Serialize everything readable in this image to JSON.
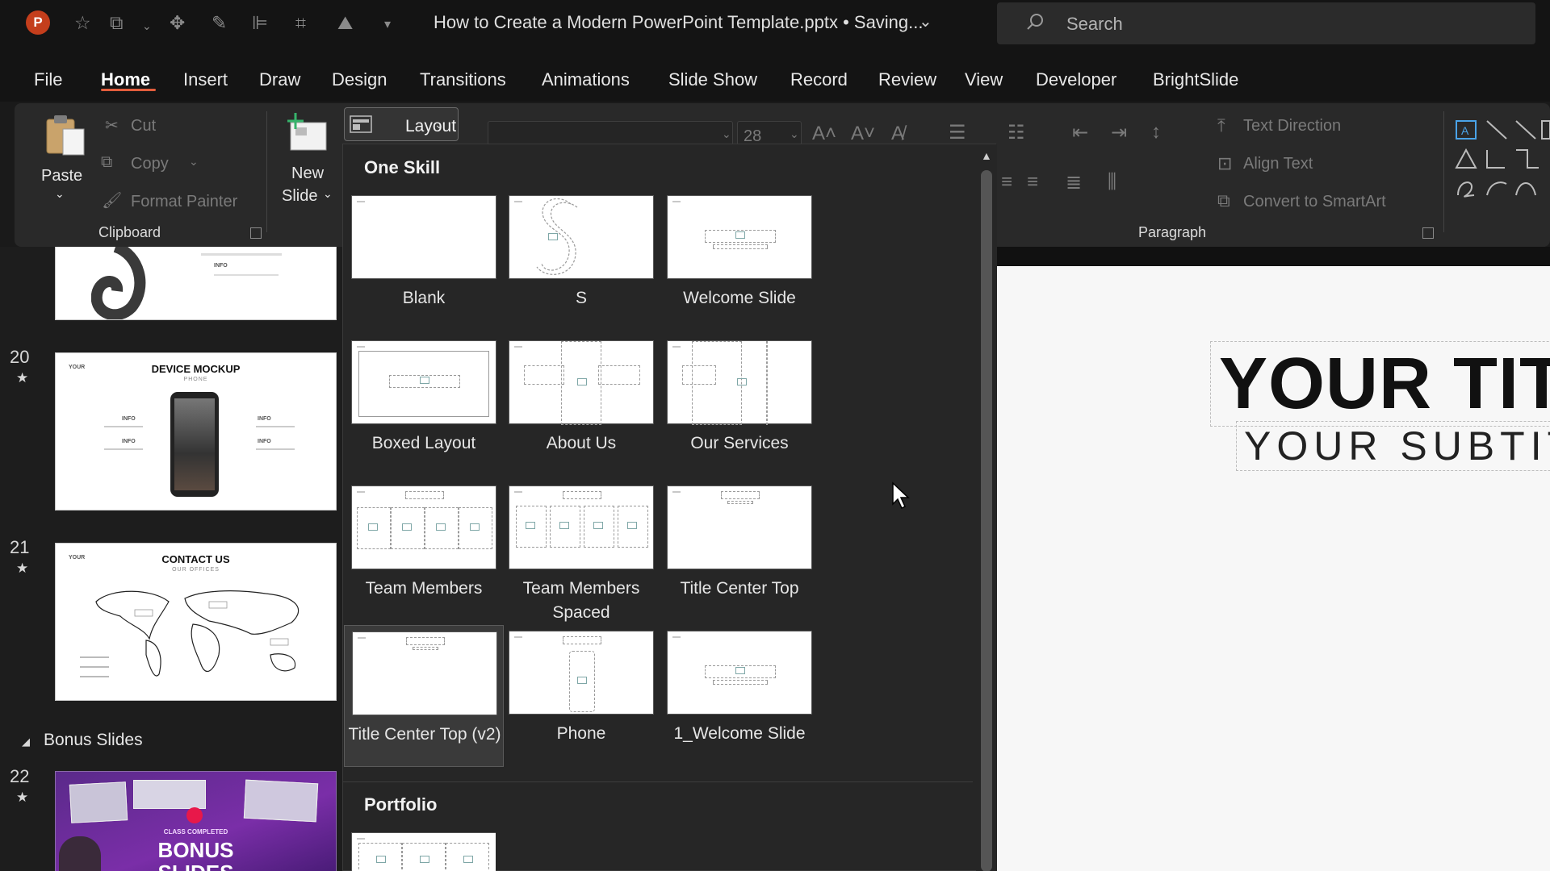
{
  "title_bar": {
    "app_logo": "P",
    "document_title": "How to Create a Modern PowerPoint Template.pptx • Saving...",
    "title_chevron": "⌄",
    "search_placeholder": "Search",
    "qat_icons": [
      "star-icon",
      "slides-icon",
      "move-icon",
      "pen-icon",
      "align-icon",
      "crop-icon",
      "picture-icon",
      "customize-icon"
    ]
  },
  "menu": {
    "tabs": [
      "File",
      "Home",
      "Insert",
      "Draw",
      "Design",
      "Transitions",
      "Animations",
      "Slide Show",
      "Record",
      "Review",
      "View",
      "Developer",
      "BrightSlide"
    ],
    "active_tab": "Home",
    "accent_color": "#e25d3c"
  },
  "ribbon": {
    "clipboard": {
      "paste": "Paste",
      "cut": "Cut",
      "copy": "Copy",
      "format_painter": "Format Painter",
      "group_label": "Clipboard"
    },
    "slides": {
      "new_slide_line1": "New",
      "new_slide_line2": "Slide",
      "layout": "Layout"
    },
    "font": {
      "font_size": "28"
    },
    "paragraph": {
      "text_direction": "Text Direction",
      "align_text": "Align Text",
      "convert_smartart": "Convert to SmartArt",
      "group_label": "Paragraph"
    }
  },
  "slide_panel": {
    "slides": [
      {
        "number": "20",
        "title": "DEVICE MOCKUP",
        "subtitle": "PHONE",
        "info": "INFO",
        "your": "YOUR"
      },
      {
        "number": "21",
        "title": "CONTACT US",
        "subtitle": "OUR OFFICES",
        "your": "YOUR"
      },
      {
        "number": "22",
        "kicker": "CLASS COMPLETED",
        "title": "BONUS",
        "subtitle": "SLIDES"
      }
    ],
    "top_partial": {
      "info": "INFO"
    },
    "section_label": "Bonus Slides"
  },
  "layout_gallery": {
    "sections": [
      {
        "name": "One Skill",
        "layouts": [
          {
            "label": "Blank"
          },
          {
            "label": "S"
          },
          {
            "label": "Welcome Slide"
          },
          {
            "label": "Boxed Layout"
          },
          {
            "label": "About Us"
          },
          {
            "label": "Our Services"
          },
          {
            "label": "Team Members"
          },
          {
            "label": "Team Members Spaced"
          },
          {
            "label": "Title Center Top"
          },
          {
            "label": "Title Center Top (v2)",
            "hovered": true
          },
          {
            "label": "Phone"
          },
          {
            "label": "1_Welcome Slide"
          }
        ]
      },
      {
        "name": "Portfolio",
        "layouts": []
      }
    ]
  },
  "slide_canvas": {
    "title": "YOUR TIT",
    "subtitle": "YOUR SUBTIT"
  }
}
